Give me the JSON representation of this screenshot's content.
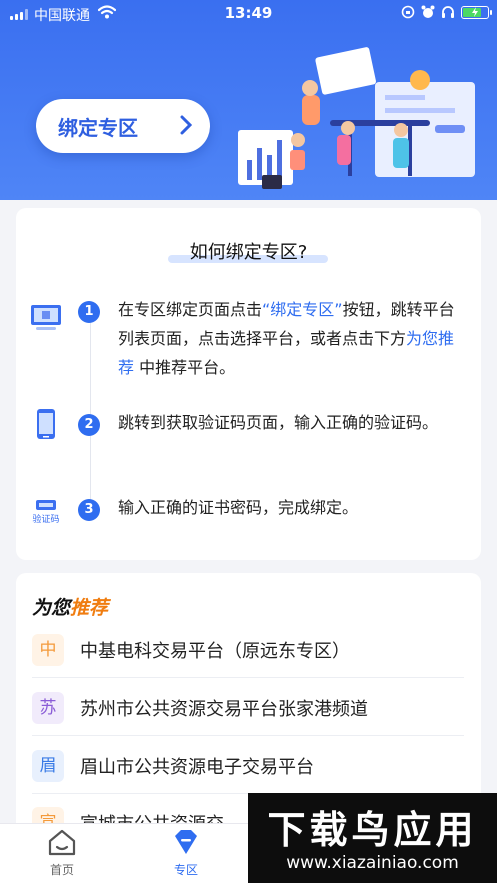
{
  "status_bar": {
    "carrier": "中国联通",
    "time": "13:49"
  },
  "hero": {
    "bind_button_label": "绑定专区"
  },
  "how_to": {
    "title": "如何绑定专区?",
    "steps": [
      {
        "number": "1",
        "icon": "monitor-icon",
        "text_pre": "在专区绑定页面点击",
        "highlight": "“绑定专区”",
        "text_mid": "按钮，跳转平台列表页面，点击选择平台，或者点击下方",
        "highlight2": "为您推荐",
        "text_post": "中推荐平台。"
      },
      {
        "number": "2",
        "icon": "phone-icon",
        "text": "跳转到获取验证码页面，输入正确的验证码。"
      },
      {
        "number": "3",
        "icon": "verification-code-icon",
        "icon_label": "验证码",
        "text": "输入正确的证书密码，完成绑定。"
      }
    ]
  },
  "recommend": {
    "title_prefix": "为您",
    "title_highlight": "推荐",
    "items": [
      {
        "badge": "中",
        "name": "中基电科交易平台（原远东专区）",
        "badge_color": "#f49a3a",
        "badge_bg": "#fff3e6"
      },
      {
        "badge": "苏",
        "name": "苏州市公共资源交易平台张家港频道",
        "badge_color": "#8a5cd6",
        "badge_bg": "#f1ebfb"
      },
      {
        "badge": "眉",
        "name": "眉山市公共资源电子交易平台",
        "badge_color": "#3a7be6",
        "badge_bg": "#e8f0fd"
      },
      {
        "badge": "宣",
        "name": "宣城市公共资源交",
        "badge_color": "#f49a3a",
        "badge_bg": "#fff3e6"
      }
    ]
  },
  "tabbar": {
    "tabs": [
      {
        "label": "首页",
        "icon": "home-icon"
      },
      {
        "label": "专区",
        "icon": "diamond-icon"
      }
    ]
  },
  "watermark": {
    "big_text": "下载鸟应用",
    "url": "www.xiazainiao.com"
  },
  "colors": {
    "brand_blue": "#2f6df0",
    "hero_bg": "#3a6ff0",
    "accent_orange": "#f07d10"
  }
}
